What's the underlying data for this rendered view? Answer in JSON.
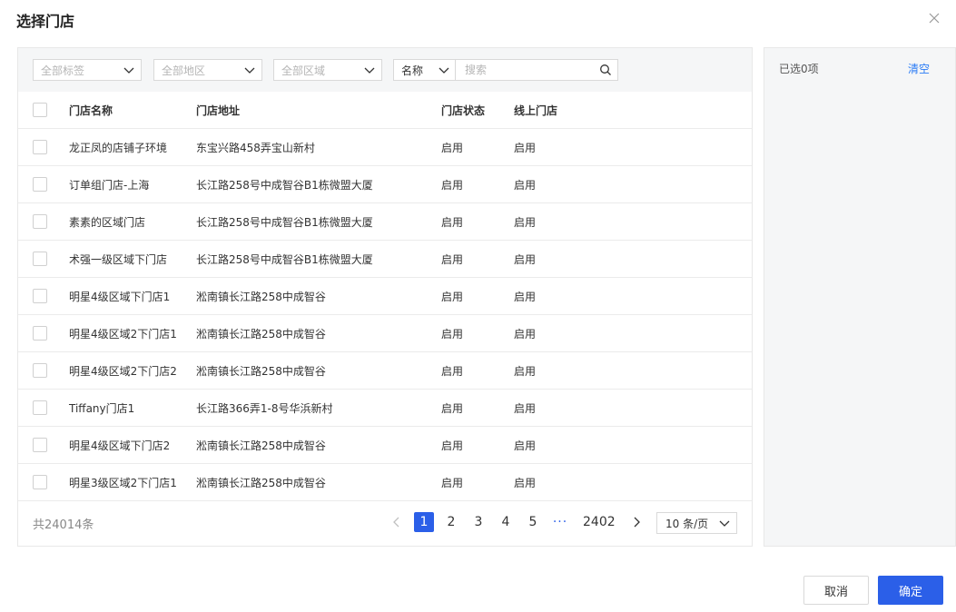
{
  "dialog": {
    "title": "选择门店"
  },
  "filters": {
    "tags": "全部标签",
    "region": "全部地区",
    "area": "全部区域",
    "search_field": "名称",
    "search_placeholder": "搜索"
  },
  "table": {
    "columns": [
      "门店名称",
      "门店地址",
      "门店状态",
      "线上门店"
    ],
    "rows": [
      [
        "龙正凤的店铺子环境",
        "东宝兴路458弄宝山新村",
        "启用",
        "启用"
      ],
      [
        "订单组门店-上海",
        "长江路258号中成智谷B1栋微盟大厦",
        "启用",
        "启用"
      ],
      [
        "素素的区域门店",
        "长江路258号中成智谷B1栋微盟大厦",
        "启用",
        "启用"
      ],
      [
        "术强一级区域下门店",
        "长江路258号中成智谷B1栋微盟大厦",
        "启用",
        "启用"
      ],
      [
        "明星4级区域下门店1",
        "淞南镇长江路258中成智谷",
        "启用",
        "启用"
      ],
      [
        "明星4级区域2下门店1",
        "淞南镇长江路258中成智谷",
        "启用",
        "启用"
      ],
      [
        "明星4级区域2下门店2",
        "淞南镇长江路258中成智谷",
        "启用",
        "启用"
      ],
      [
        "Tiffany门店1",
        "长江路366弄1-8号华浜新村",
        "启用",
        "启用"
      ],
      [
        "明星4级区域下门店2",
        "淞南镇长江路258中成智谷",
        "启用",
        "启用"
      ],
      [
        "明星3级区域2下门店1",
        "淞南镇长江路258中成智谷",
        "启用",
        "启用"
      ]
    ]
  },
  "pagination": {
    "total": "共24014条",
    "pages": [
      "1",
      "2",
      "3",
      "4",
      "5"
    ],
    "ellipsis": "···",
    "last": "2402",
    "current": "1",
    "page_size": "10 条/页"
  },
  "selection": {
    "count_label": "已选0项",
    "clear_label": "清空"
  },
  "actions": {
    "cancel": "取消",
    "confirm": "确定"
  },
  "colors": {
    "primary": "#2b5fe8",
    "link": "#2b7cf6"
  }
}
